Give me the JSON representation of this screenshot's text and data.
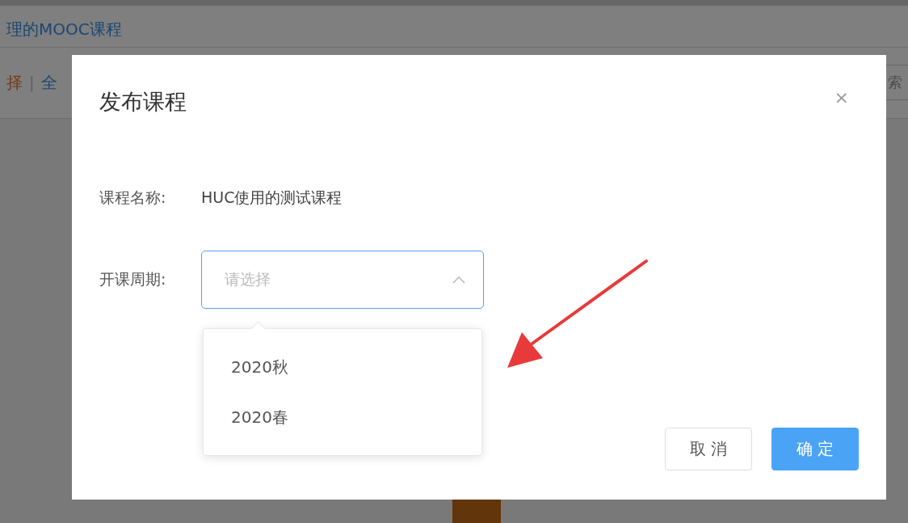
{
  "background_page": {
    "heading": "理的MOOC课程",
    "filter_active": "择",
    "filter_separator": "|",
    "filter_all": "全",
    "search_hint": "索"
  },
  "dialog": {
    "title": "发布课程",
    "close": "×",
    "fields": [
      {
        "kind": "text",
        "label": "课程名称:",
        "value": "HUC使用的测试课程"
      },
      {
        "kind": "select",
        "label": "开课周期:",
        "placeholder": "请选择",
        "expanded": true
      }
    ],
    "options": [
      {
        "label": "2020秋",
        "selected": false
      },
      {
        "label": "2020春",
        "selected": false
      }
    ],
    "buttons": [
      {
        "label": "取 消",
        "primary": false
      },
      {
        "label": "确 定",
        "primary": true
      }
    ]
  }
}
